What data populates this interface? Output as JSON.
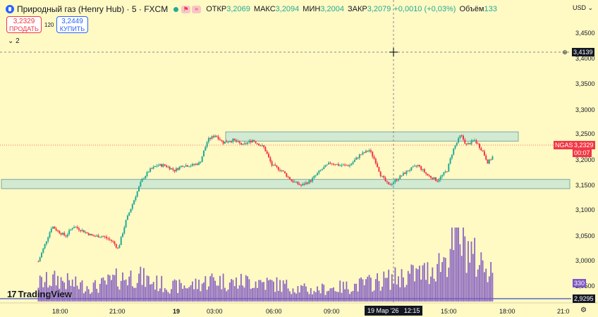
{
  "header": {
    "title": "Природный газ (Henry Hub) · 5 · FXCM",
    "open_label": "ОТКР",
    "open": "3,2069",
    "high_label": "МАКС",
    "high": "3,2094",
    "low_label": "МИН",
    "low": "3,2004",
    "close_label": "ЗАКР",
    "close": "3,2079",
    "change": "+0,0010 (+0,03%)",
    "volume_label": "Объём",
    "volume": "133"
  },
  "trade": {
    "sell_price": "3,2329",
    "sell_label": "ПРОДАТЬ",
    "spread": "120",
    "buy_price": "3,2449",
    "buy_label": "КУПИТЬ"
  },
  "indicators_toggle": "2",
  "currency": "USD",
  "price_axis": {
    "ticks": [
      "3,4500",
      "3,4000",
      "3,3500",
      "3,3000",
      "3,2500",
      "3,2000",
      "3,1500",
      "3,1000",
      "3,0500",
      "3,0000",
      "2,9500"
    ],
    "crosshair_price": "3,4139",
    "symbol_tag": "NGAS",
    "last_price": "3,2329",
    "countdown": "00:07",
    "volume_tag": "330",
    "bottom_price": "2,9295"
  },
  "time_axis": {
    "ticks": [
      "18:00",
      "21:00",
      "19",
      "03:00",
      "06:00",
      "09:00",
      "15:00",
      "18:00",
      "21:0"
    ],
    "crosshair_time": "19 Мар '26",
    "crosshair_clock": "12:15"
  },
  "branding": "TradingView",
  "colors": {
    "background": "#fff9c4",
    "up": "#22ab94",
    "down": "#f23645",
    "volume": "#7e57c2",
    "zone": "#b2dfdb"
  },
  "chart_data": {
    "type": "candlestick",
    "symbol": "NGAS",
    "interval": "5",
    "ylim": [
      2.92,
      3.48
    ],
    "zones": [
      [
        3.242,
        3.252
      ],
      [
        3.148,
        3.158
      ]
    ],
    "path": [
      [
        17.0,
        3.0
      ],
      [
        17.3,
        3.03
      ],
      [
        17.7,
        3.07
      ],
      [
        18.0,
        3.06
      ],
      [
        18.4,
        3.05
      ],
      [
        18.8,
        3.07
      ],
      [
        19.3,
        3.06
      ],
      [
        19.8,
        3.05
      ],
      [
        20.3,
        3.05
      ],
      [
        20.8,
        3.04
      ],
      [
        21.1,
        3.025
      ],
      [
        21.5,
        3.08
      ],
      [
        21.9,
        3.12
      ],
      [
        22.3,
        3.16
      ],
      [
        22.7,
        3.18
      ],
      [
        23.1,
        3.19
      ],
      [
        23.5,
        3.19
      ],
      [
        24.0,
        3.18
      ],
      [
        24.4,
        3.19
      ],
      [
        24.9,
        3.19
      ],
      [
        25.3,
        3.195
      ],
      [
        25.7,
        3.24
      ],
      [
        26.1,
        3.25
      ],
      [
        26.5,
        3.235
      ],
      [
        27.0,
        3.24
      ],
      [
        27.5,
        3.23
      ],
      [
        28.0,
        3.24
      ],
      [
        28.6,
        3.225
      ],
      [
        29.0,
        3.19
      ],
      [
        29.5,
        3.18
      ],
      [
        30.0,
        3.16
      ],
      [
        30.5,
        3.15
      ],
      [
        31.0,
        3.16
      ],
      [
        31.5,
        3.18
      ],
      [
        32.0,
        3.195
      ],
      [
        32.5,
        3.19
      ],
      [
        33.0,
        3.19
      ],
      [
        33.5,
        3.21
      ],
      [
        34.0,
        3.22
      ],
      [
        34.3,
        3.2
      ],
      [
        34.6,
        3.17
      ],
      [
        35.0,
        3.15
      ],
      [
        35.5,
        3.165
      ],
      [
        36.0,
        3.18
      ],
      [
        36.5,
        3.19
      ],
      [
        37.0,
        3.17
      ],
      [
        37.5,
        3.16
      ],
      [
        38.0,
        3.18
      ],
      [
        38.3,
        3.22
      ],
      [
        38.7,
        3.25
      ],
      [
        39.0,
        3.23
      ],
      [
        39.4,
        3.24
      ],
      [
        39.8,
        3.22
      ],
      [
        40.1,
        3.195
      ],
      [
        40.4,
        3.21
      ]
    ],
    "volume_path": [
      [
        17.0,
        0.25
      ],
      [
        18.0,
        0.3
      ],
      [
        19.0,
        0.22
      ],
      [
        20.0,
        0.2
      ],
      [
        21.0,
        0.3
      ],
      [
        22.0,
        0.35
      ],
      [
        23.0,
        0.25
      ],
      [
        24.0,
        0.2
      ],
      [
        25.0,
        0.22
      ],
      [
        26.0,
        0.3
      ],
      [
        27.0,
        0.25
      ],
      [
        28.0,
        0.28
      ],
      [
        29.0,
        0.24
      ],
      [
        30.0,
        0.2
      ],
      [
        31.0,
        0.15
      ],
      [
        32.0,
        0.18
      ],
      [
        33.0,
        0.2
      ],
      [
        34.0,
        0.25
      ],
      [
        35.0,
        0.3
      ],
      [
        36.0,
        0.35
      ],
      [
        37.0,
        0.4
      ],
      [
        38.0,
        0.6
      ],
      [
        38.5,
        0.9
      ],
      [
        39.0,
        0.75
      ],
      [
        39.5,
        0.55
      ],
      [
        40.0,
        0.5
      ],
      [
        40.4,
        0.45
      ]
    ]
  }
}
